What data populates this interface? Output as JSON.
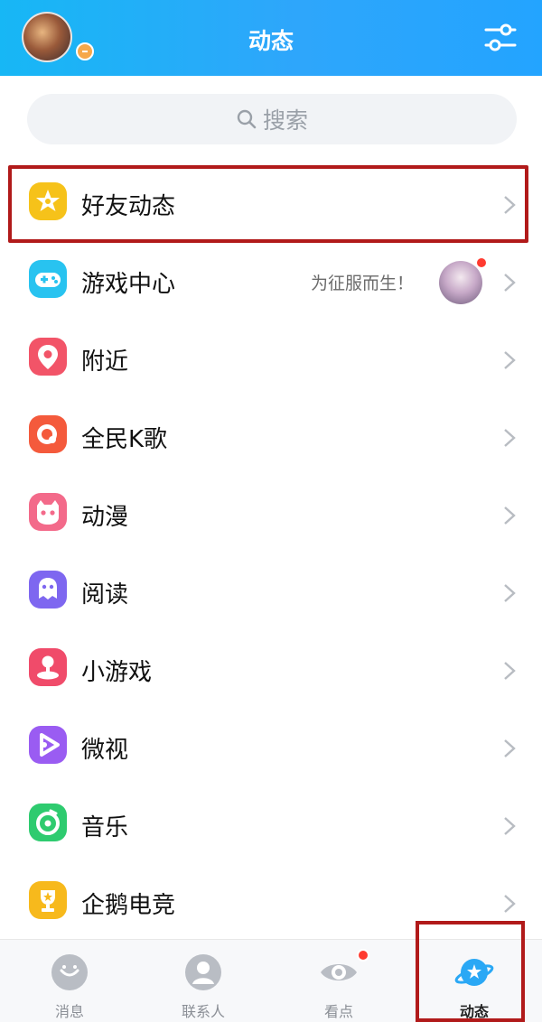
{
  "header": {
    "title": "动态",
    "avatar_icon": "user-avatar",
    "settings_icon": "filter-sliders-icon"
  },
  "search": {
    "placeholder": "搜索"
  },
  "menu": {
    "items": [
      {
        "id": "friends-feed",
        "label": "好友动态",
        "icon": "star-icon",
        "color": "#f6c21a"
      },
      {
        "id": "game-center",
        "label": "游戏中心",
        "desc": "为征服而生！",
        "icon": "gamepad-icon",
        "color": "#28c3f0"
      },
      {
        "id": "nearby",
        "label": "附近",
        "icon": "location-pin-icon",
        "color": "#f25468"
      },
      {
        "id": "karaoke",
        "label": "全民K歌",
        "icon": "karaoke-icon",
        "color": "#f45a3c"
      },
      {
        "id": "anime",
        "label": "动漫",
        "icon": "cat-face-icon",
        "color": "#f36a8a"
      },
      {
        "id": "reading",
        "label": "阅读",
        "icon": "book-bird-icon",
        "color": "#7e67f0"
      },
      {
        "id": "mini-games",
        "label": "小游戏",
        "icon": "joystick-icon",
        "color": "#f04b6a"
      },
      {
        "id": "weishi",
        "label": "微视",
        "icon": "play-icon",
        "color": "#9a5cf2"
      },
      {
        "id": "music",
        "label": "音乐",
        "icon": "music-disc-icon",
        "color": "#2ecb6f"
      },
      {
        "id": "esports",
        "label": "企鹅电竞",
        "icon": "trophy-icon",
        "color": "#f7b91c"
      }
    ]
  },
  "bottom_nav": {
    "tabs": [
      {
        "label": "消息",
        "icon": "message-icon"
      },
      {
        "label": "联系人",
        "icon": "contacts-icon"
      },
      {
        "label": "看点",
        "icon": "eye-icon"
      },
      {
        "label": "动态",
        "icon": "planet-icon",
        "active": true
      }
    ]
  },
  "colors": {
    "header_gradient_start": "#17b7f5",
    "header_gradient_end": "#23a4ff",
    "highlight_border": "#b11a1a",
    "badge_red": "#ff3b30"
  }
}
